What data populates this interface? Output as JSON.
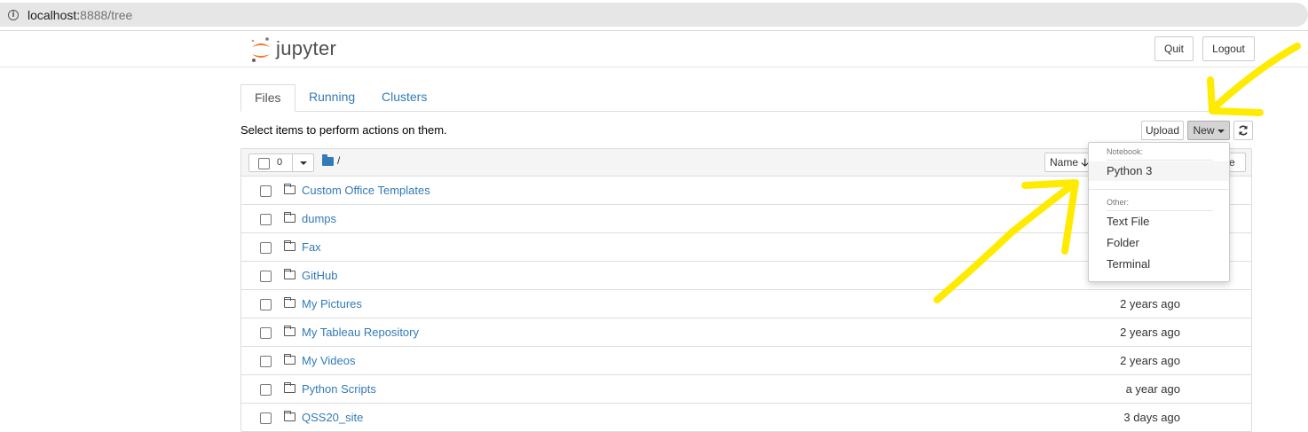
{
  "browser": {
    "url_host": "localhost:",
    "url_rest": "8888/tree"
  },
  "header": {
    "logo_text": "jupyter",
    "quit_label": "Quit",
    "logout_label": "Logout"
  },
  "tabs": [
    {
      "label": "Files",
      "active": true
    },
    {
      "label": "Running",
      "active": false
    },
    {
      "label": "Clusters",
      "active": false
    }
  ],
  "toolbar": {
    "hint": "Select items to perform actions on them.",
    "upload_label": "Upload",
    "new_label": "New",
    "refresh_icon": "refresh-icon"
  },
  "list_header": {
    "selected_count": "0",
    "breadcrumb": "/",
    "name_sort_label": "Name",
    "size_sort_label": "ze"
  },
  "files": [
    {
      "name": "Custom Office Templates",
      "modified": ""
    },
    {
      "name": "dumps",
      "modified": ""
    },
    {
      "name": "Fax",
      "modified": ""
    },
    {
      "name": "GitHub",
      "modified": ""
    },
    {
      "name": "My Pictures",
      "modified": "2 years ago"
    },
    {
      "name": "My Tableau Repository",
      "modified": "2 years ago"
    },
    {
      "name": "My Videos",
      "modified": "2 years ago"
    },
    {
      "name": "Python Scripts",
      "modified": "a year ago"
    },
    {
      "name": "QSS20_site",
      "modified": "3 days ago"
    }
  ],
  "new_menu": {
    "notebook_header": "Notebook:",
    "python3": "Python 3",
    "other_header": "Other:",
    "text_file": "Text File",
    "folder": "Folder",
    "terminal": "Terminal"
  },
  "colors": {
    "link": "#337ab7",
    "annotation": "#ffeb00",
    "logo_orange": "#f37726"
  }
}
